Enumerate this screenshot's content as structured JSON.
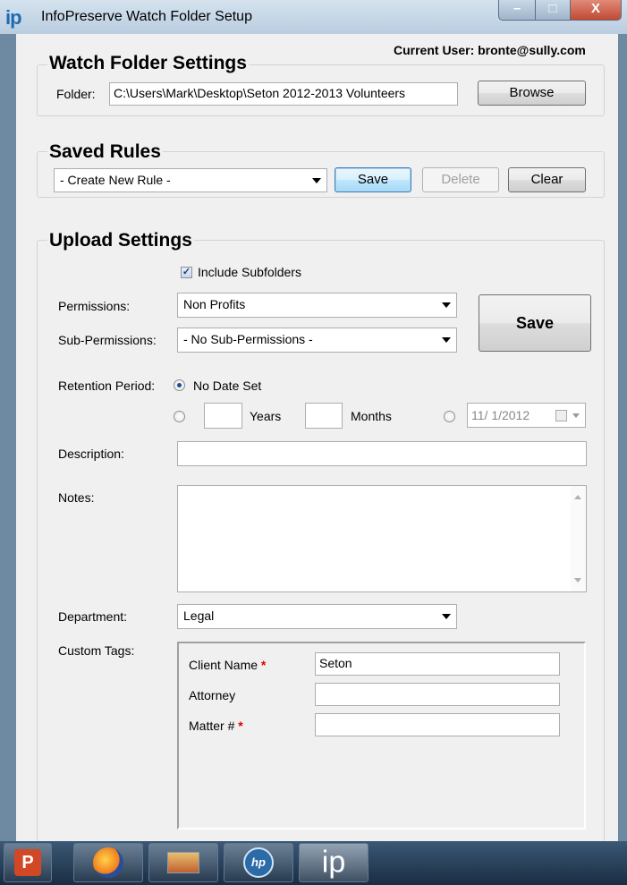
{
  "window": {
    "title": "InfoPreserve Watch Folder Setup",
    "logo": "ip",
    "controls": {
      "minimize": "–",
      "maximize": "□",
      "close": "X"
    }
  },
  "current_user": "Current User: bronte@sully.com",
  "watch_folder": {
    "title": "Watch Folder Settings",
    "folder_label": "Folder:",
    "folder_value": "C:\\Users\\Mark\\Desktop\\Seton 2012-2013 Volunteers",
    "browse_label": "Browse"
  },
  "saved_rules": {
    "title": "Saved Rules",
    "selected_rule": "- Create New Rule -",
    "save_label": "Save",
    "delete_label": "Delete",
    "clear_label": "Clear"
  },
  "upload": {
    "title": "Upload Settings",
    "include_subfolders_label": "Include Subfolders",
    "include_subfolders_checked": true,
    "permissions_label": "Permissions:",
    "permissions_value": "Non Profits",
    "sub_permissions_label": "Sub-Permissions:",
    "sub_permissions_value": "- No Sub-Permissions -",
    "save_label": "Save",
    "retention_label": "Retention Period:",
    "no_date_label": "No Date Set",
    "years_label": "Years",
    "months_label": "Months",
    "date_value": "11/  1/2012",
    "description_label": "Description:",
    "notes_label": "Notes:",
    "department_label": "Department:",
    "department_value": "Legal",
    "custom_tags_label": "Custom Tags:",
    "tags": [
      {
        "label": "Client Name",
        "required": "*",
        "value": "Seton"
      },
      {
        "label": "Attorney",
        "required": "",
        "value": ""
      },
      {
        "label": "Matter #",
        "required": "*",
        "value": ""
      }
    ]
  },
  "taskbar": {
    "apps": [
      "powerpoint-icon",
      "firefox-icon",
      "remote-desktop-icon",
      "hp-icon",
      "infopreserve-icon"
    ],
    "ip_label": "ip",
    "ppt_label": "P",
    "hp_label": "hp"
  }
}
